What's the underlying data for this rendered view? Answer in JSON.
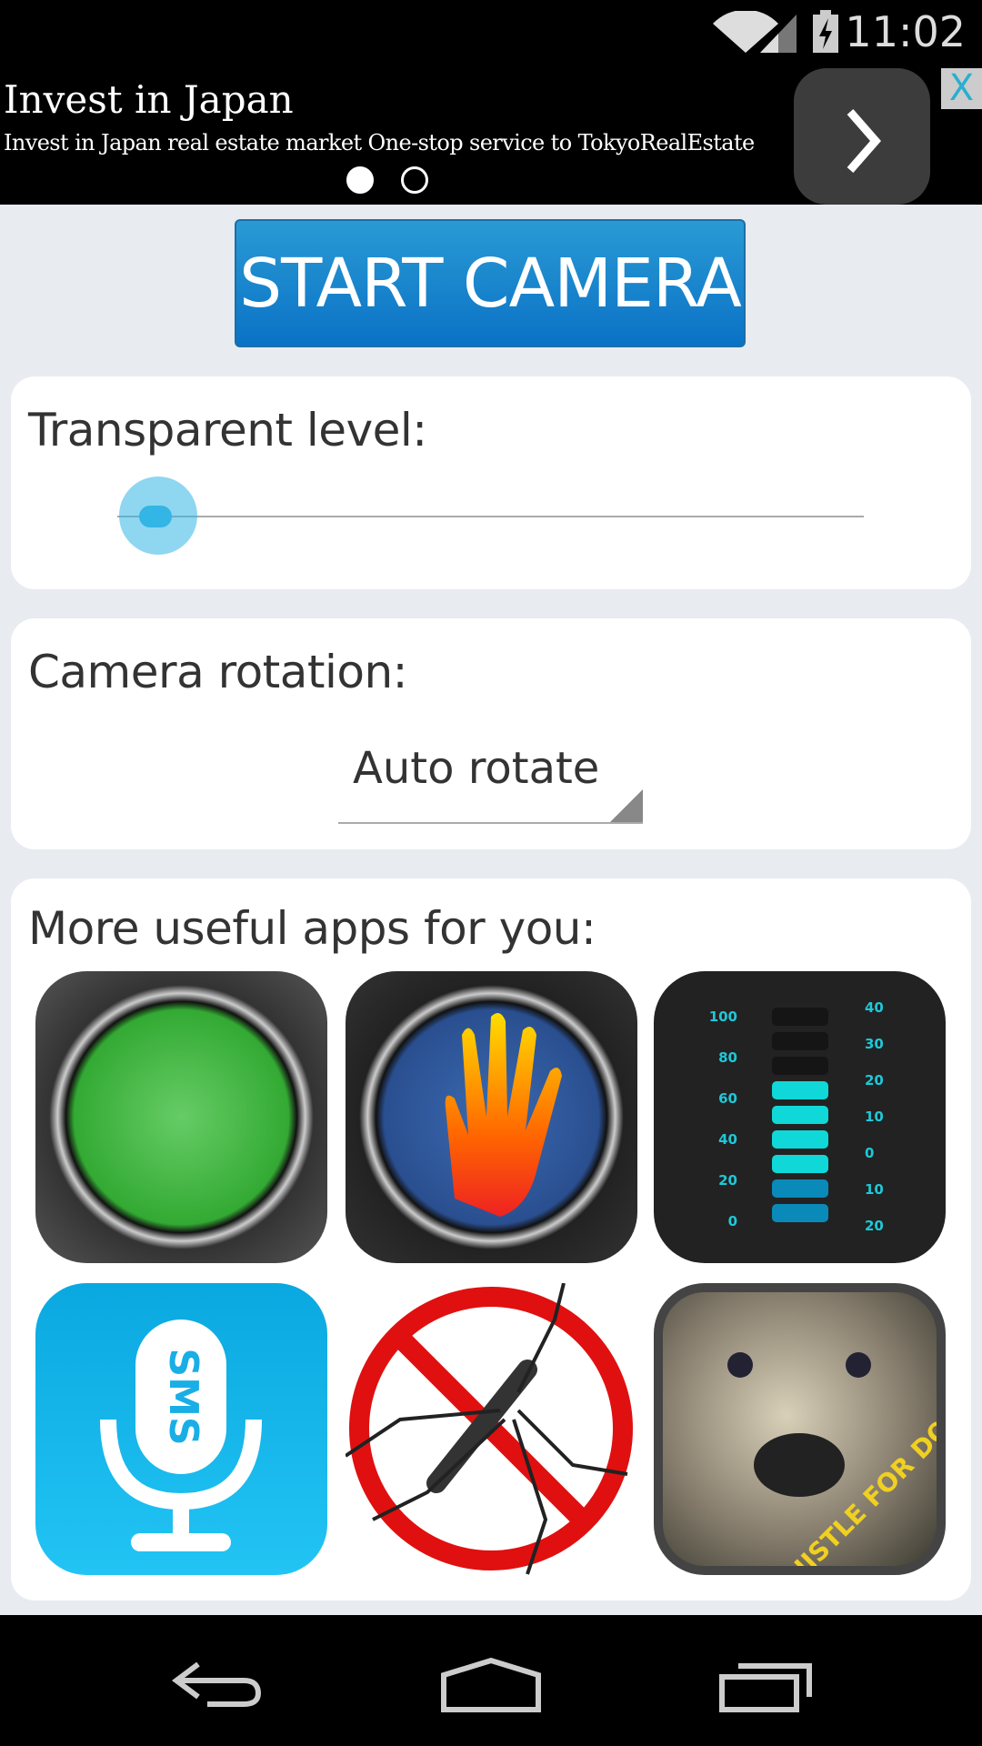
{
  "status_bar": {
    "time": "11:02",
    "icons": [
      "wifi-icon",
      "signal-icon",
      "battery-charging-icon"
    ]
  },
  "ad": {
    "title": "Invest in Japan",
    "description": "Invest in Japan real estate market One-stop service to TokyoRealEstate",
    "pages": 2,
    "current_page": 1,
    "close_label": "X"
  },
  "start_button": "START CAMERA",
  "transparency": {
    "label": "Transparent level:",
    "value_percent": 3
  },
  "rotation": {
    "label": "Camera rotation:",
    "selected": "Auto rotate"
  },
  "apps": {
    "label": "More useful apps for you:",
    "items": [
      {
        "name": "night-vision-app"
      },
      {
        "name": "thermal-camera-app"
      },
      {
        "name": "thermometer-app",
        "left_scale": [
          "100",
          "80",
          "60",
          "40",
          "20",
          "0"
        ],
        "right_scale": [
          "40",
          "30",
          "20",
          "10",
          "0",
          "10",
          "20"
        ]
      },
      {
        "name": "sms-voice-app",
        "badge": "SMS"
      },
      {
        "name": "anti-mosquito-app"
      },
      {
        "name": "dog-whistle-app",
        "text": "WHISTLE FOR DOG"
      }
    ]
  },
  "nav": {
    "icons": [
      "back-icon",
      "home-icon",
      "recent-apps-icon"
    ]
  },
  "colors": {
    "accent": "#33b5e5",
    "button": "#0a72c6"
  }
}
